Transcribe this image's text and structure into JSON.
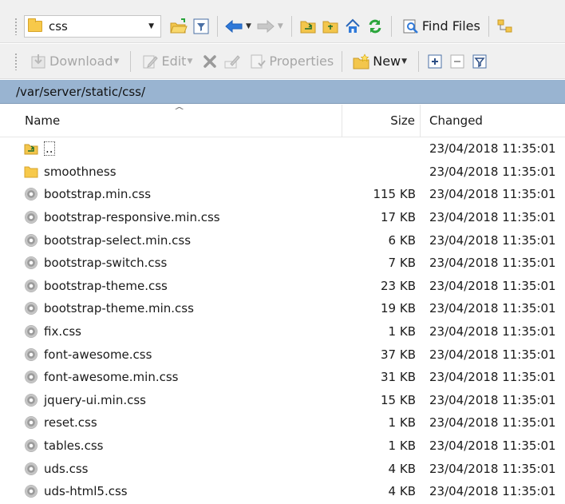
{
  "toolbar1": {
    "path_combo": "css",
    "find_files": "Find Files"
  },
  "toolbar2": {
    "download": "Download",
    "edit": "Edit",
    "properties": "Properties",
    "new": "New"
  },
  "path": "/var/server/static/css/",
  "columns": {
    "name": "Name",
    "size": "Size",
    "changed": "Changed"
  },
  "files": [
    {
      "name": "..",
      "size": "",
      "changed": "23/04/2018 11:35:01",
      "type": "parent"
    },
    {
      "name": "smoothness",
      "size": "",
      "changed": "23/04/2018 11:35:01",
      "type": "folder"
    },
    {
      "name": "bootstrap.min.css",
      "size": "115 KB",
      "changed": "23/04/2018 11:35:01",
      "type": "file"
    },
    {
      "name": "bootstrap-responsive.min.css",
      "size": "17 KB",
      "changed": "23/04/2018 11:35:01",
      "type": "file"
    },
    {
      "name": "bootstrap-select.min.css",
      "size": "6 KB",
      "changed": "23/04/2018 11:35:01",
      "type": "file"
    },
    {
      "name": "bootstrap-switch.css",
      "size": "7 KB",
      "changed": "23/04/2018 11:35:01",
      "type": "file"
    },
    {
      "name": "bootstrap-theme.css",
      "size": "23 KB",
      "changed": "23/04/2018 11:35:01",
      "type": "file"
    },
    {
      "name": "bootstrap-theme.min.css",
      "size": "19 KB",
      "changed": "23/04/2018 11:35:01",
      "type": "file"
    },
    {
      "name": "fix.css",
      "size": "1 KB",
      "changed": "23/04/2018 11:35:01",
      "type": "file"
    },
    {
      "name": "font-awesome.css",
      "size": "37 KB",
      "changed": "23/04/2018 11:35:01",
      "type": "file"
    },
    {
      "name": "font-awesome.min.css",
      "size": "31 KB",
      "changed": "23/04/2018 11:35:01",
      "type": "file"
    },
    {
      "name": "jquery-ui.min.css",
      "size": "15 KB",
      "changed": "23/04/2018 11:35:01",
      "type": "file"
    },
    {
      "name": "reset.css",
      "size": "1 KB",
      "changed": "23/04/2018 11:35:01",
      "type": "file"
    },
    {
      "name": "tables.css",
      "size": "1 KB",
      "changed": "23/04/2018 11:35:01",
      "type": "file"
    },
    {
      "name": "uds.css",
      "size": "4 KB",
      "changed": "23/04/2018 11:35:01",
      "type": "file"
    },
    {
      "name": "uds-html5.css",
      "size": "4 KB",
      "changed": "23/04/2018 11:35:01",
      "type": "file"
    }
  ]
}
